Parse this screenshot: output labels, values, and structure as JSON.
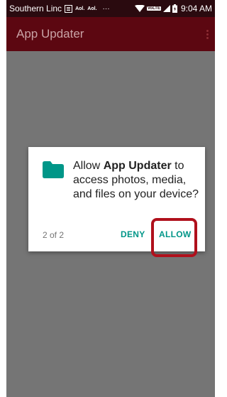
{
  "status_bar": {
    "carrier": "Southern Linc",
    "aol_1": "Aol.",
    "aol_2": "Aol.",
    "dots": "···",
    "volte": "VoLTE",
    "time": "9:04 AM"
  },
  "app_bar": {
    "title": "App Updater"
  },
  "dialog": {
    "message_prefix": "Allow ",
    "app_name": "App Updater",
    "message_suffix": " to access photos, media, and files on your device?",
    "counter": "2 of 2",
    "deny_label": "DENY",
    "allow_label": "ALLOW"
  },
  "colors": {
    "status_bar": "#2a0a0f",
    "app_bar": "#5c0711",
    "scrim": "#757575",
    "accent": "#009688",
    "highlight": "#b0101c"
  },
  "icons": {
    "dialog": "folder-icon",
    "app_bar": "overflow-menu-icon"
  }
}
